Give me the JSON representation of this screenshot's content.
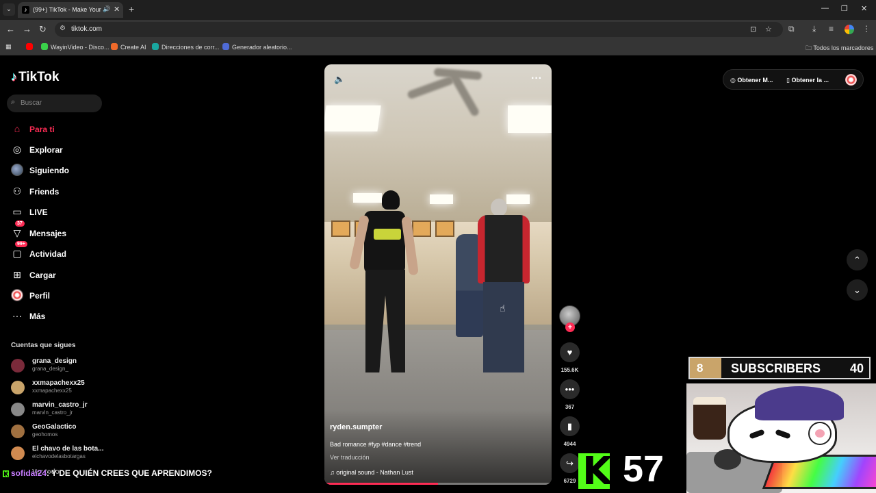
{
  "browser": {
    "tab_title": "(99+) TikTok - Make Your Day",
    "url": "tiktok.com",
    "bookmarks": [
      {
        "label": "",
        "color": "#ff0000"
      },
      {
        "label": "WayinVideo - Disco...",
        "color": "#3ad24a"
      },
      {
        "label": "Create AI",
        "color": "#f06a2a"
      },
      {
        "label": "Direcciones de corr...",
        "color": "#1aa7a0"
      },
      {
        "label": "Generador aleatorio...",
        "color": "#4f6bd6"
      }
    ],
    "all_bookmarks": "Todos los marcadores"
  },
  "tiktok": {
    "logo": "TikTok",
    "search_placeholder": "Buscar",
    "nav": [
      {
        "label": "Para ti",
        "icon": "home-icon",
        "active": true
      },
      {
        "label": "Explorar",
        "icon": "compass-icon"
      },
      {
        "label": "Siguiendo",
        "icon": "avatar-icon"
      },
      {
        "label": "Friends",
        "icon": "friends-icon"
      },
      {
        "label": "LIVE",
        "icon": "live-icon"
      },
      {
        "label": "Mensajes",
        "icon": "messages-icon",
        "badge": "37"
      },
      {
        "label": "Actividad",
        "icon": "activity-icon",
        "badge": "99+"
      },
      {
        "label": "Cargar",
        "icon": "upload-icon"
      },
      {
        "label": "Perfil",
        "icon": "profile-icon"
      },
      {
        "label": "Más",
        "icon": "more-icon"
      }
    ],
    "following_title": "Cuentas que sigues",
    "following": [
      {
        "name": "grana_design",
        "handle": "grana_design_",
        "color": "#7a2a3a"
      },
      {
        "name": "xxmapachexx25",
        "handle": "xxmapachexx25",
        "color": "#c9a46a"
      },
      {
        "name": "marvin_castro_jr",
        "handle": "marvin_castro_jr",
        "color": "#888888"
      },
      {
        "name": "GeoGalactico",
        "handle": "geohomos",
        "color": "#a07040"
      },
      {
        "name": "El chavo de las bota...",
        "handle": "elchavodelasbotargas",
        "color": "#d08a50"
      },
      {
        "name": "Ver todo",
        "handle": "",
        "color": "#444444"
      }
    ],
    "video": {
      "author": "ryden.sumpter",
      "caption": "Bad romance #fyp #dance #trend",
      "translate": "Ver traducción",
      "sound": "original sound - Nathan Lust",
      "progress": 0.5
    },
    "actions": {
      "likes": "155.6K",
      "comments": "367",
      "saves": "4944",
      "shares": "6729"
    },
    "get_buttons": [
      "Obtener M...",
      "Obtener la ..."
    ]
  },
  "overlay": {
    "sub_left": "8",
    "sub_label": "SUBSCRIBERS",
    "sub_right": "40",
    "kick_count": "57",
    "chat_user": "sofidai24",
    "chat_message": ": Y DE QUIÉN CREES QUE APRENDIMOS?"
  }
}
